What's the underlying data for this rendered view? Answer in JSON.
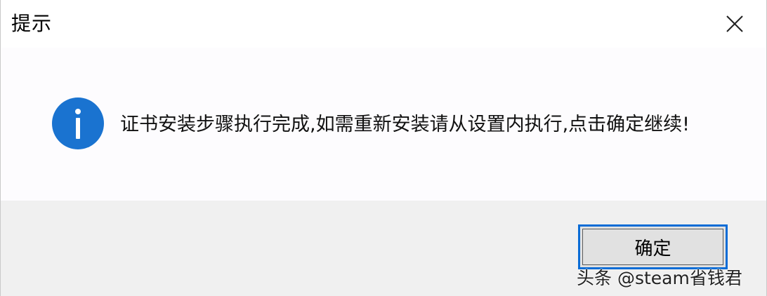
{
  "dialog": {
    "title": "提示",
    "message": "证书安装步骤执行完成,如需重新安装请从设置内执行,点击确定继续!",
    "ok_label": "确定",
    "icons": {
      "close": "close-icon",
      "info": "info-icon"
    },
    "colors": {
      "info_icon": "#1a73d0",
      "button_border": "#0a6cd6",
      "footer_bg": "#f0f0f0"
    }
  },
  "watermark": {
    "text": "头条 @steam省钱君"
  }
}
